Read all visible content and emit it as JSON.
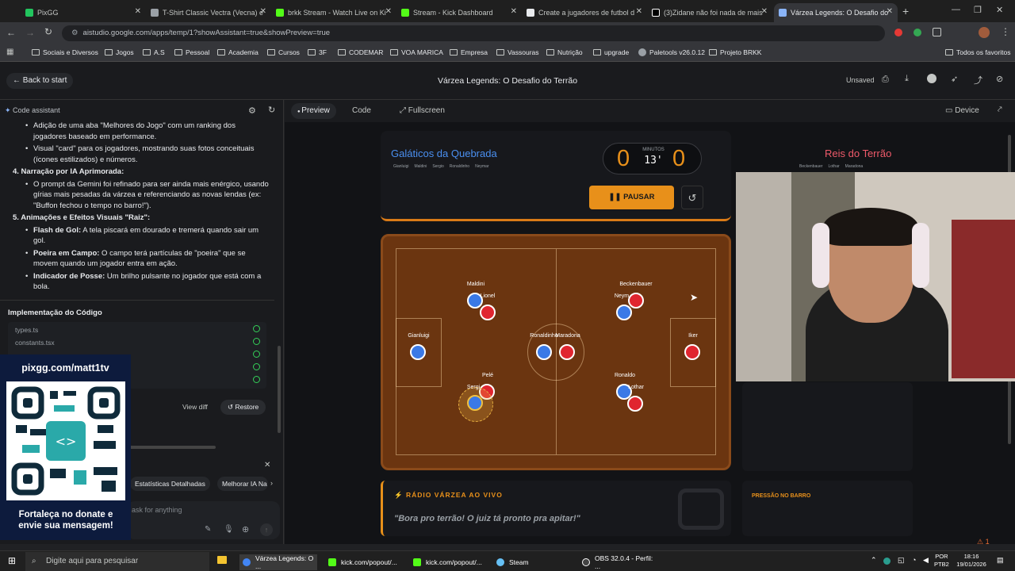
{
  "browser": {
    "tabs": [
      {
        "label": "PixGG",
        "color": "#22c55e"
      },
      {
        "label": "T-Shirt Classic Vectra (Vecna) e",
        "color": "#9aa0a6"
      },
      {
        "label": "brkk Stream - Watch Live on Ki",
        "color": "#53fc18"
      },
      {
        "label": "Stream - Kick Dashboard",
        "color": "#53fc18"
      },
      {
        "label": "Create a jugadores de futbol d",
        "color": "#e8eaed"
      },
      {
        "label": "(3)Zidane não foi nada de mais",
        "color": "#000000"
      },
      {
        "label": "Várzea Legends: O Desafio do",
        "color": "#8ab4f8"
      }
    ],
    "url": "aistudio.google.com/apps/temp/1?showAssistant=true&showPreview=true",
    "bookmarks": [
      "Sociais e Diversos",
      "Jogos",
      "A.S",
      "Pessoal",
      "Academia",
      "Cursos",
      "3F",
      "CODEMAR",
      "VOA MARICA",
      "Empresa",
      "Vassouras",
      "Nutrição",
      "upgrade",
      "Paletools v26.0.12",
      "Projeto BRKK"
    ],
    "bookmarks_right": "Todos os favoritos"
  },
  "app": {
    "back": "Back to start",
    "title": "Várzea Legends: O Desafio do Terrão",
    "status": "Unsaved",
    "assistant_label": "Code assistant",
    "preview_tab": "Preview",
    "code_tab": "Code",
    "fullscreen": "Fullscreen",
    "device": "Device"
  },
  "assistant": {
    "b1": "Adição de uma aba \"Melhores do Jogo\" com um ranking dos jogadores baseado em performance.",
    "b2": "Visual \"card\" para os jogadores, mostrando suas fotos conceituais (ícones estilizados) e números.",
    "h4": "4. Narração por IA Aprimorada:",
    "b3": "O prompt da Gemini foi refinado para ser ainda mais enérgico, usando gírias mais pesadas da várzea e referenciando as novas lendas (ex: \"Buffon fechou o tempo no barro!\").",
    "h5": "5. Animações e Efeitos Visuais \"Raiz\":",
    "b4t": "Flash de Gol:",
    "b4": " A tela piscará em dourado e tremerá quando sair um gol.",
    "b5t": "Poeira em Campo:",
    "b5": " O campo terá partículas de \"poeira\" que se movem quando um jogador entra em ação.",
    "b6t": "Indicador de Posse:",
    "b6": " Um brilho pulsante no jogador que está com a bola.",
    "impl": "Implementação do Código",
    "files": [
      "types.ts",
      "constants.tsx"
    ],
    "view_diff": "View diff",
    "restore": "Restore",
    "chip1": "Estatísticas Detalhadas",
    "chip2": "Melhorar IA Na",
    "ask": "ask for anything"
  },
  "overlay": {
    "url": "pixgg.com/matt1tv",
    "msg": "Fortaleça no donate e envie sua mensagem!"
  },
  "game": {
    "home_name": "Galáticos da Quebrada",
    "home_players": [
      "Gianluigi",
      "Maldini",
      "Sergio",
      "Ronaldinho",
      "Neymar"
    ],
    "away_name": "Reis do Terrão",
    "away_players": [
      "Beckenbauer",
      "Lothar",
      "Maradona",
      "Lionel",
      "Pelé"
    ],
    "score_home": "0",
    "score_away": "0",
    "minutes_label": "MINUTOS",
    "minute": "13'",
    "pause": "PAUSAR",
    "pitch_names": {
      "maldini": "Maldini",
      "lionel": "Lionel",
      "becken": "Beckenbauer",
      "neym": "Neym",
      "gian": "Gianluigi",
      "ron": "Ronaldinho",
      "mara": "Maradona",
      "iker": "Iker",
      "pele": "Pelé",
      "sergio": "Sergi",
      "ronaldo": "Ronaldo",
      "lothar": "Lothar"
    },
    "radio_title": "RÁDIO VÁRZEA AO VIVO",
    "radio_text": "\"Bora pro terrão! O juiz tá pronto pra apitar!\"",
    "pressure": "PRESSÃO NO BARRO"
  },
  "taskbar": {
    "search": "Digite aqui para pesquisar",
    "apps": [
      "Várzea Legends: O ...",
      "kick.com/popout/...",
      "kick.com/popout/...",
      "Steam",
      "OBS 32.0.4 - Perfil: ..."
    ],
    "lang1": "POR",
    "lang2": "PTB2",
    "time": "18:16",
    "date": "19/01/2026",
    "notif": "1"
  },
  "colors": {
    "accent": "#e8901a",
    "home": "#3a79e6",
    "away": "#e0252f",
    "pitch": "#6b3510"
  }
}
